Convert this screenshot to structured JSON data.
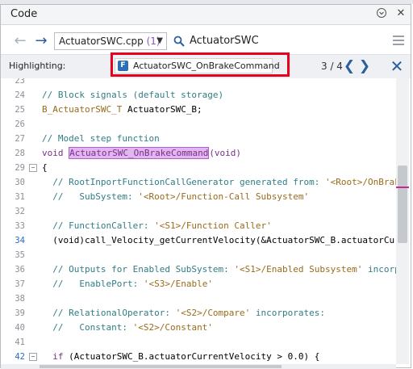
{
  "panel": {
    "title": "Code",
    "collapse_glyph": "▾",
    "close_glyph": "✕"
  },
  "nav": {
    "back_glyph": "←",
    "forward_glyph": "→",
    "file_name": "ActuatorSWC.cpp",
    "file_count": "(1)",
    "dropdown_glyph": "▼",
    "search_text": "ActuatorSWC"
  },
  "highlight": {
    "label": "Highlighting:",
    "badge": "F",
    "function_name": "ActuatorSWC_OnBrakeCommand",
    "count": "3 / 4",
    "prev_glyph": "❮",
    "next_glyph": "❯",
    "close_glyph": "✕"
  },
  "colors": {
    "accent": "#2a5f9e",
    "highlight_box": "#e8001c",
    "selection": "#e2b6ef",
    "comment": "#2f7e86",
    "string": "#9a6b1a",
    "keyword": "#7a2e8c"
  },
  "code_lines": [
    {
      "n": "23",
      "fold": "",
      "parts": []
    },
    {
      "n": "24",
      "fold": "",
      "parts": [
        {
          "c": "cm",
          "t": "// Block signals (default storage)"
        }
      ]
    },
    {
      "n": "25",
      "fold": "",
      "parts": [
        {
          "c": "str",
          "t": "B_ActuatorSWC_T"
        },
        {
          "c": "",
          "t": " ActuatorSWC_B;"
        }
      ]
    },
    {
      "n": "26",
      "fold": "",
      "parts": []
    },
    {
      "n": "27",
      "fold": "",
      "parts": [
        {
          "c": "cm",
          "t": "// Model step function"
        }
      ]
    },
    {
      "n": "28",
      "fold": "",
      "parts": [
        {
          "c": "kw",
          "t": "void "
        },
        {
          "c": "hl",
          "t": "ActuatorSWC_OnBrakeCommand"
        },
        {
          "c": "kw",
          "t": "(void)"
        }
      ]
    },
    {
      "n": "29",
      "fold": "−",
      "parts": [
        {
          "c": "",
          "t": "{"
        }
      ]
    },
    {
      "n": "30",
      "fold": "",
      "parts": [
        {
          "c": "cm",
          "t": "  // RootInportFunctionCallGenerator generated from: "
        },
        {
          "c": "str",
          "t": "'<Root>/OnBrake"
        }
      ]
    },
    {
      "n": "31",
      "fold": "",
      "parts": [
        {
          "c": "cm",
          "t": "  //   SubSystem: "
        },
        {
          "c": "str",
          "t": "'<Root>/Function-Call Subsystem'"
        }
      ]
    },
    {
      "n": "32",
      "fold": "",
      "parts": []
    },
    {
      "n": "33",
      "fold": "",
      "parts": [
        {
          "c": "cm",
          "t": "  // FunctionCaller: "
        },
        {
          "c": "str",
          "t": "'<S1>/Function Caller'"
        }
      ]
    },
    {
      "n": "34",
      "fold": "",
      "cur": true,
      "parts": [
        {
          "c": "",
          "t": "  (void)call_Velocity_getCurrentVelocity(&ActuatorSWC_B.actuatorCurr"
        }
      ]
    },
    {
      "n": "35",
      "fold": "",
      "parts": []
    },
    {
      "n": "36",
      "fold": "",
      "parts": [
        {
          "c": "cm",
          "t": "  // Outputs for Enabled SubSystem: "
        },
        {
          "c": "str",
          "t": "'<S1>/Enabled Subsystem'"
        },
        {
          "c": "cm",
          "t": " incorpo"
        }
      ]
    },
    {
      "n": "37",
      "fold": "",
      "parts": [
        {
          "c": "cm",
          "t": "  //   EnablePort: "
        },
        {
          "c": "str",
          "t": "'<S3>/Enable'"
        }
      ]
    },
    {
      "n": "38",
      "fold": "",
      "parts": []
    },
    {
      "n": "39",
      "fold": "",
      "parts": [
        {
          "c": "cm",
          "t": "  // RelationalOperator: "
        },
        {
          "c": "str",
          "t": "'<S2>/Compare'"
        },
        {
          "c": "cm",
          "t": " incorporates:"
        }
      ]
    },
    {
      "n": "40",
      "fold": "",
      "parts": [
        {
          "c": "cm",
          "t": "  //   Constant: "
        },
        {
          "c": "str",
          "t": "'<S2>/Constant'"
        }
      ]
    },
    {
      "n": "41",
      "fold": "",
      "parts": []
    },
    {
      "n": "42",
      "fold": "−",
      "cur": true,
      "parts": [
        {
          "c": "kw",
          "t": "  if"
        },
        {
          "c": "",
          "t": " (ActuatorSWC_B.actuatorCurrentVelocity > 0.0) {"
        }
      ]
    }
  ]
}
